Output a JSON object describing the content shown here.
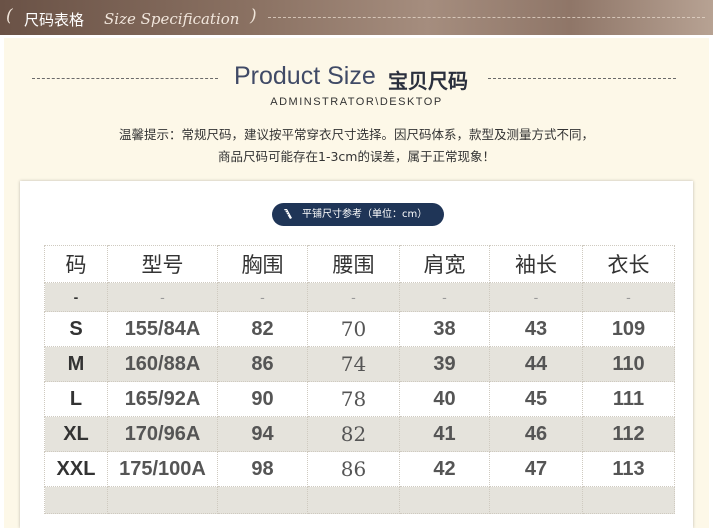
{
  "banner": {
    "paren_left": "(",
    "title_zh": "尺码表格",
    "title_en": "Size Specification",
    "paren_right": ")"
  },
  "heading": {
    "title_en": "Product Size",
    "title_zh": "宝贝尺码",
    "path": "ADMINSTRATOR\\DESKTOP"
  },
  "notice": {
    "line1": "温馨提示：常规尺码，建议按平常穿衣尺寸选择。因尺码体系，款型及测量方式不同，",
    "line2": "商品尺码可能存在1-3cm的误差，属于正常现象！"
  },
  "table_label": "平铺尺寸参考（单位：cm）",
  "size_table": {
    "headers": [
      "码",
      "型号",
      "胸围",
      "腰围",
      "肩宽",
      "袖长",
      "衣长"
    ],
    "placeholder_row": [
      "-",
      "-",
      "-",
      "-",
      "-",
      "-",
      "-"
    ],
    "rows": [
      [
        "S",
        "155/84A",
        "82",
        "70",
        "38",
        "43",
        "109"
      ],
      [
        "M",
        "160/88A",
        "86",
        "74",
        "39",
        "44",
        "110"
      ],
      [
        "L",
        "165/92A",
        "90",
        "78",
        "40",
        "45",
        "111"
      ],
      [
        "XL",
        "170/96A",
        "94",
        "82",
        "41",
        "46",
        "112"
      ],
      [
        "XXL",
        "175/100A",
        "98",
        "86",
        "42",
        "47",
        "113"
      ]
    ]
  },
  "colors": {
    "banner": "#7a6254",
    "panel_bg": "#fdf8e8",
    "pill_bg": "#1f3557",
    "alt_row": "#e5e3dc"
  }
}
